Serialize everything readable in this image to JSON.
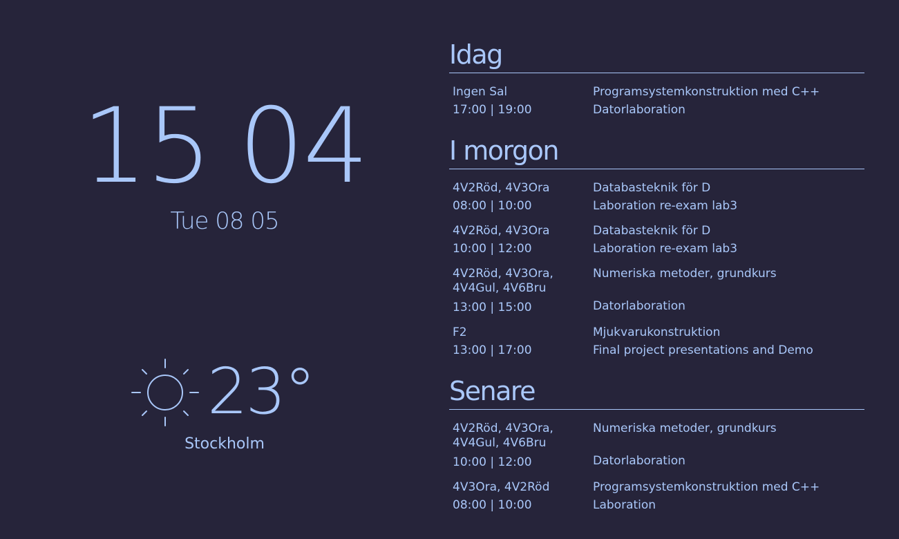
{
  "clock": {
    "hours": "15",
    "minutes": "04",
    "date": "Tue 08 05"
  },
  "weather": {
    "icon": "sun-icon",
    "temperature": "23°",
    "city": "Stockholm"
  },
  "sections": {
    "today": {
      "title": "Idag",
      "events": [
        {
          "room": "Ingen Sal",
          "time": "17:00 | 19:00",
          "course": "Programsystemkonstruktion med C++",
          "type": "Datorlaboration"
        }
      ]
    },
    "tomorrow": {
      "title": "I morgon",
      "events": [
        {
          "room": "4V2Röd, 4V3Ora",
          "time": "08:00 | 10:00",
          "course": "Databasteknik för D",
          "type": "Laboration re-exam lab3"
        },
        {
          "room": "4V2Röd, 4V3Ora",
          "time": "10:00 | 12:00",
          "course": "Databasteknik för D",
          "type": "Laboration re-exam lab3"
        },
        {
          "room": "4V2Röd, 4V3Ora, 4V4Gul, 4V6Bru",
          "time": "13:00 | 15:00",
          "course": "Numeriska metoder, grundkurs",
          "type": "Datorlaboration"
        },
        {
          "room": "F2",
          "time": "13:00 | 17:00",
          "course": "Mjukvarukonstruktion",
          "type": "Final project presentations and Demo"
        }
      ]
    },
    "later": {
      "title": "Senare",
      "events": [
        {
          "room": "4V2Röd, 4V3Ora, 4V4Gul, 4V6Bru",
          "time": "10:00 | 12:00",
          "course": "Numeriska metoder, grundkurs",
          "type": "Datorlaboration"
        },
        {
          "room": "4V3Ora, 4V2Röd",
          "time": "08:00 | 10:00",
          "course": "Programsystemkonstruktion med C++",
          "type": "Laboration"
        }
      ]
    }
  }
}
